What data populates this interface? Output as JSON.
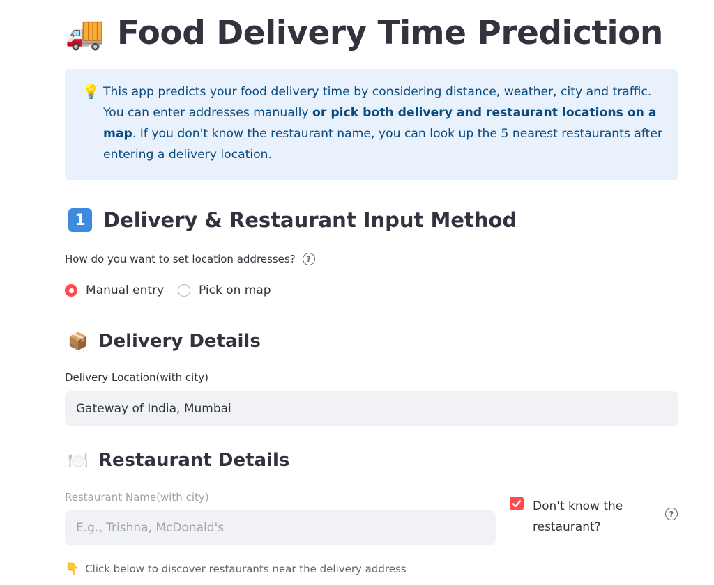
{
  "app_title": "Food Delivery Time Prediction",
  "title_icon": "delivery-truck-icon",
  "info": {
    "icon": "lightbulb-icon",
    "text_start": "This app predicts your food delivery time by considering distance, weather, city and traffic. You can enter addresses manually ",
    "text_bold": "or pick both delivery and restaurant locations on a map",
    "text_end": ". If you don't know the restaurant name, you can look up the 5 nearest restaurants after entering a delivery location."
  },
  "input_method": {
    "step_badge": "1",
    "heading": "Delivery & Restaurant Input Method",
    "question": "How do you want to set location addresses?",
    "options": [
      {
        "label": "Manual entry",
        "selected": true
      },
      {
        "label": "Pick on map",
        "selected": false
      }
    ]
  },
  "delivery": {
    "icon": "package-icon",
    "heading": "Delivery Details",
    "field_label": "Delivery Location(with city)",
    "field_value": "Gateway of India, Mumbai"
  },
  "restaurant": {
    "icon": "plate-cutlery-icon",
    "heading": "Restaurant Details",
    "field_label": "Restaurant Name(with city)",
    "field_placeholder": "E.g., Trishna, McDonald's",
    "checkbox_label_line1": "Don't know the",
    "checkbox_label_line2": "restaurant?",
    "checkbox_checked": true,
    "hint_icon": "pointing-down-icon",
    "hint": "Click below to discover restaurants near the delivery address"
  },
  "colors": {
    "accent": "#ff4b4b",
    "info_bg": "#e8f1fc",
    "info_text": "#0b4a7d",
    "input_bg": "#f0f2f6"
  }
}
